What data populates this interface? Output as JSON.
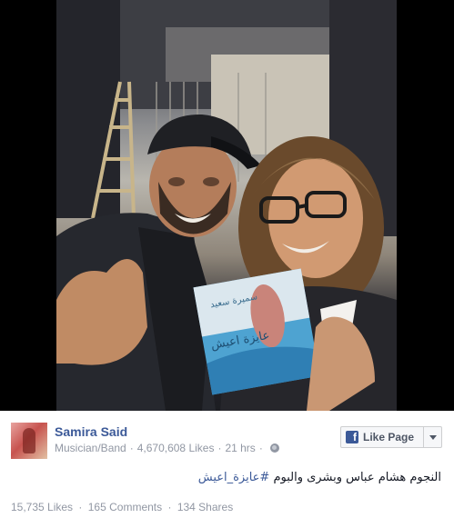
{
  "post": {
    "page_name": "Samira Said",
    "category": "Musician/Band",
    "likes_count": "4,670,608 Likes",
    "time": "21 hrs",
    "separator": "·",
    "like_page_label": "Like Page",
    "message_text": "النجوم هشام عباس وبشرى والبوم ",
    "hashtag": "#عايزة_اعيش",
    "stats": {
      "likes": "15,735 Likes",
      "comments": "165 Comments",
      "shares": "134 Shares"
    }
  },
  "photo": {
    "description_icon": "photo-of-two-people-with-cd",
    "cd_title": "عايزة اعيش",
    "cd_artist": "سميرة سعيد"
  },
  "colors": {
    "link_blue": "#3b5998",
    "meta_gray": "#9197a3",
    "text": "#141823"
  }
}
